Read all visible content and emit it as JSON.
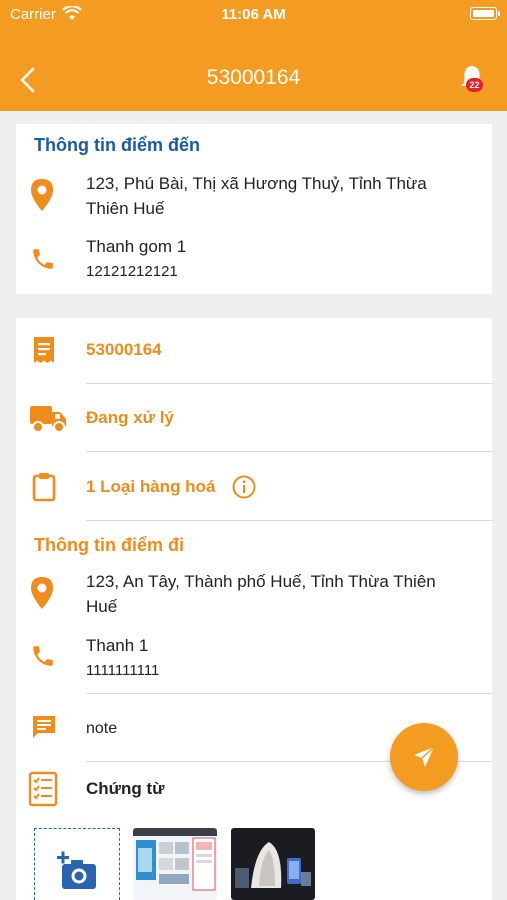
{
  "status_bar": {
    "carrier": "Carrier",
    "time": "11:06 AM"
  },
  "nav": {
    "title": "53000164",
    "notification_count": "22",
    "back_icon": "chevron-left-icon",
    "bell_icon": "bell-icon"
  },
  "destination": {
    "title": "Thông tin điểm đến",
    "address": "123, Phú Bài, Thị xã Hương Thuỷ, Tỉnh Thừa Thiên Huế",
    "contact_name": "Thanh gom 1",
    "phone": "12121212121"
  },
  "order": {
    "code": "53000164",
    "status": "Đang xử lý",
    "goods": "1 Loại hàng hoá"
  },
  "origin": {
    "title": "Thông tin điểm đi",
    "address": "123, An Tây, Thành phố Huế, Tỉnh Thừa Thiên Huế",
    "contact_name": "Thanh 1",
    "phone": "1111111111",
    "note": "note"
  },
  "documents": {
    "title": "Chứng từ"
  },
  "colors": {
    "accent": "#f49b22",
    "title_blue": "#1a5aa6",
    "badge_red": "#e8202a"
  }
}
